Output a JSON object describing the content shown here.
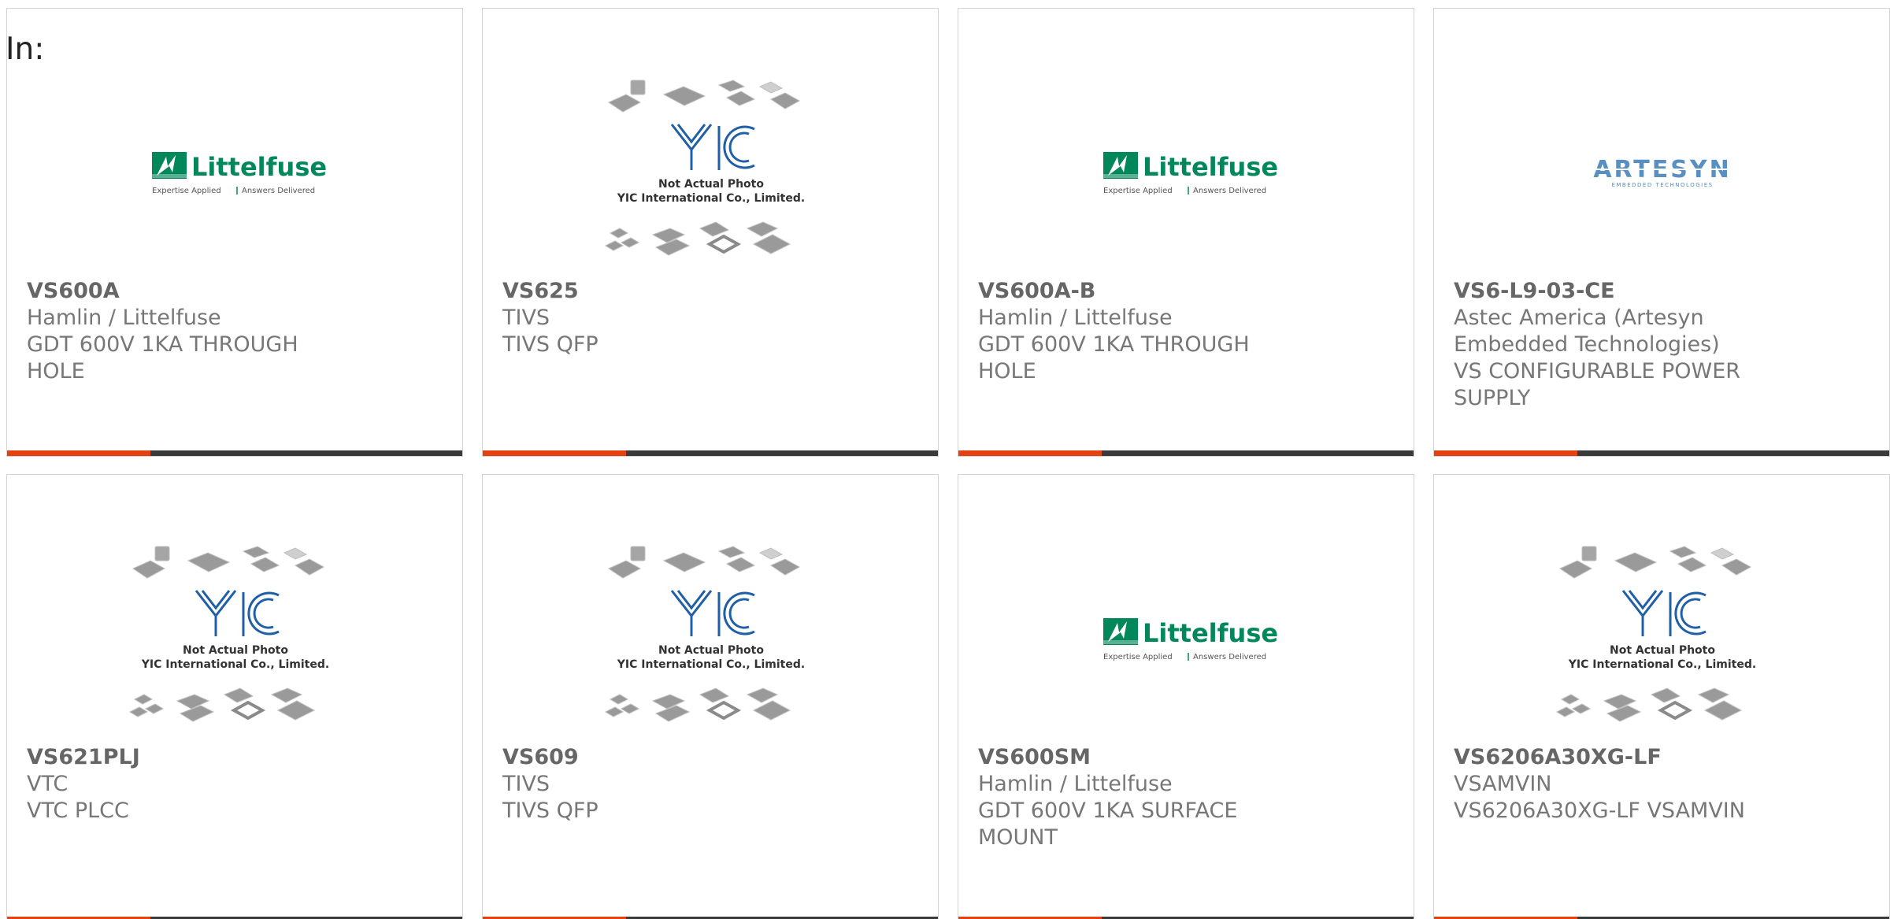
{
  "filter_label": "In:",
  "colors": {
    "accent": "#e5400f",
    "bar": "#3a3a3a",
    "littelfuse_green": "#00875a",
    "yic_blue": "#1f5fa8",
    "artesyn_blue": "#5a8fc2"
  },
  "logos": {
    "littelfuse": {
      "name": "Littelfuse",
      "tagline_left": "Expertise Applied",
      "tagline_right": "Answers Delivered"
    },
    "yic": {
      "mark": "YIC",
      "line1": "Not Actual Photo",
      "line2": "YIC International Co., Limited."
    },
    "artesyn": {
      "name": "ARTESYN",
      "sub": "EMBEDDED TECHNOLOGIES"
    }
  },
  "products": [
    {
      "part": "VS600A",
      "mfr": "Hamlin / Littelfuse",
      "desc": "GDT 600V 1KA THROUGH HOLE",
      "image": "littelfuse-logo"
    },
    {
      "part": "VS625",
      "mfr": "TIVS",
      "desc": "TIVS QFP",
      "image": "yic-placeholder"
    },
    {
      "part": "VS600A-B",
      "mfr": "Hamlin / Littelfuse",
      "desc": "GDT 600V 1KA THROUGH HOLE",
      "image": "littelfuse-logo"
    },
    {
      "part": "VS6-L9-03-CE",
      "mfr": "Astec America (Artesyn Embedded Technologies)",
      "desc": "VS CONFIGURABLE POWER SUPPLY",
      "image": "artesyn-logo"
    },
    {
      "part": "VS621PLJ",
      "mfr": "VTC",
      "desc": "VTC PLCC",
      "image": "yic-placeholder"
    },
    {
      "part": "VS609",
      "mfr": "TIVS",
      "desc": "TIVS QFP",
      "image": "yic-placeholder"
    },
    {
      "part": "VS600SM",
      "mfr": "Hamlin / Littelfuse",
      "desc": "GDT 600V 1KA SURFACE MOUNT",
      "image": "littelfuse-logo"
    },
    {
      "part": "VS6206A30XG-LF",
      "mfr": "VSAMVIN",
      "desc": "VS6206A30XG-LF VSAMVIN",
      "image": "yic-placeholder"
    }
  ]
}
